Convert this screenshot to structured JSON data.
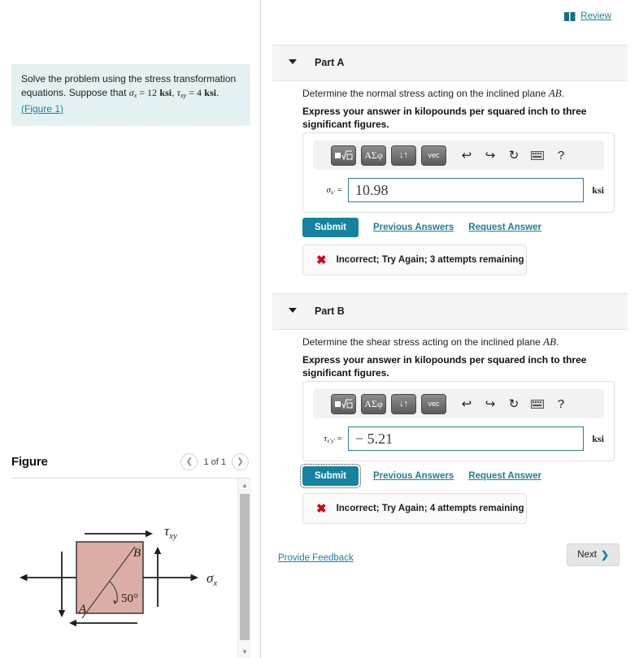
{
  "problem": {
    "line1": "Solve the problem using the stress transformation",
    "line2_pre": "equations. Suppose that ",
    "sigma_sym": "σ",
    "sigma_sub": "x",
    "eq1": " = ",
    "val1": "12",
    "unit1": "ksi",
    "comma": ", ",
    "tau_sym": "τ",
    "tau_sub": "xy",
    "eq2": " = ",
    "val2": "4",
    "unit2": "ksi",
    "period": ".",
    "figure_link": "(Figure 1)"
  },
  "figure_panel": {
    "title": "Figure",
    "prev_icon": "chevron-left",
    "count_label": "1 of 1",
    "next_icon": "chevron-right",
    "scroll_up_icon": "triangle-up",
    "scroll_down_icon": "triangle-down",
    "diagram": {
      "label_A": "A",
      "label_B": "B",
      "angle_label": "50°",
      "tau_label": "τ",
      "tau_sub": "xy",
      "sigma_label": "σ",
      "sigma_sub": "x",
      "square_fill": "#dcada6",
      "stroke": "#1d1d1d"
    }
  },
  "header": {
    "review_label": "Review",
    "review_icon": "book-icon"
  },
  "parts": [
    {
      "caret_icon": "caret-down-icon",
      "title": "Part A",
      "question_pre": "Determine the normal stress acting on the inclined plane ",
      "question_math": "AB",
      "question_post": ".",
      "instruction": "Express your answer in kilopounds per squared inch to three significant figures.",
      "toolbar": {
        "btn_template": "▣√▫",
        "btn_greek": "ΑΣφ",
        "btn_arrows": "↓↑",
        "btn_vec": "vec",
        "icon_undo": "undo-icon",
        "icon_redo": "redo-icon",
        "icon_reset": "reset-icon",
        "icon_keyboard": "keyboard-icon",
        "icon_help": "?"
      },
      "answer": {
        "label_sym": "σ",
        "label_sub": "x'",
        "equals": "=",
        "value": "10.98",
        "placeholder": "",
        "units": "ksi"
      },
      "submit_label": "Submit",
      "previous_answers_label": "Previous Answers",
      "request_answer_label": "Request Answer",
      "feedback": {
        "icon": "x-mark-icon",
        "text": "Incorrect; Try Again; 3 attempts remaining"
      }
    },
    {
      "caret_icon": "caret-down-icon",
      "title": "Part B",
      "question_pre": "Determine the shear stress acting on the inclined plane ",
      "question_math": "AB",
      "question_post": ".",
      "instruction": "Express your answer in kilopounds per squared inch to three significant figures.",
      "toolbar": {
        "btn_template": "▣√▫",
        "btn_greek": "ΑΣφ",
        "btn_arrows": "↓↑",
        "btn_vec": "vec",
        "icon_undo": "undo-icon",
        "icon_redo": "redo-icon",
        "icon_reset": "reset-icon",
        "icon_keyboard": "keyboard-icon",
        "icon_help": "?"
      },
      "answer": {
        "label_sym": "τ",
        "label_sub": "x'y'",
        "equals": "=",
        "value": "− 5.21",
        "placeholder": "",
        "units": "ksi"
      },
      "submit_label": "Submit",
      "previous_answers_label": "Previous Answers",
      "request_answer_label": "Request Answer",
      "feedback": {
        "icon": "x-mark-icon",
        "text": "Incorrect; Try Again; 4 attempts remaining"
      }
    }
  ],
  "footer": {
    "provide_feedback_label": "Provide Feedback",
    "next_label": "Next",
    "next_icon": "chevron-right-icon"
  },
  "colors": {
    "accent_teal": "#1582a0",
    "link_teal": "#1b7f96",
    "hint_bg": "#e4f1f2",
    "error_red": "#d0021b",
    "panel_grey": "#f5f5f5"
  }
}
